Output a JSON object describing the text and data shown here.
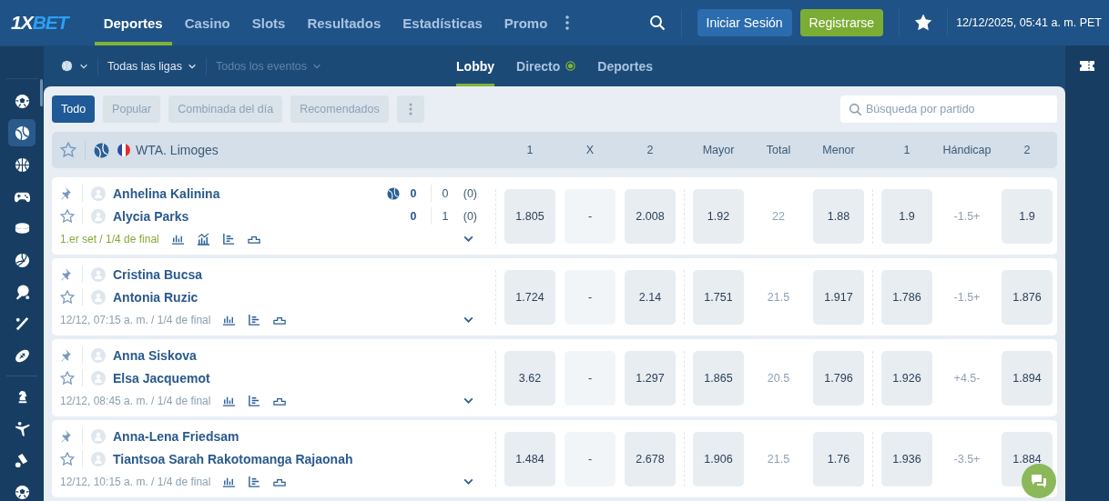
{
  "header": {
    "logo": [
      "1X",
      "BET"
    ],
    "nav": [
      {
        "label": "Deportes",
        "selected": true
      },
      {
        "label": "Casino",
        "selected": false
      },
      {
        "label": "Slots",
        "selected": false
      },
      {
        "label": "Resultados",
        "selected": false
      },
      {
        "label": "Estadísticas",
        "selected": false
      },
      {
        "label": "Promo",
        "selected": false
      }
    ],
    "login": "Iniciar Sesión",
    "register": "Registrarse",
    "datetime": "12/12/2025, 05:41 a. m. PET"
  },
  "sidebar": {
    "items": [
      {
        "kind": "soccer",
        "selected": false
      },
      {
        "kind": "tennis",
        "selected": true
      },
      {
        "kind": "basketball",
        "selected": false
      },
      {
        "kind": "gamepad",
        "selected": false
      },
      {
        "kind": "puck",
        "selected": false
      },
      {
        "kind": "volleyball",
        "selected": false
      },
      {
        "kind": "pingpong",
        "selected": false
      },
      {
        "kind": "cricket",
        "selected": false
      },
      {
        "kind": "rugby",
        "selected": false
      },
      {
        "kind": "chess",
        "selected": false
      },
      {
        "kind": "kick",
        "selected": false
      },
      {
        "kind": "shuttlecock",
        "selected": false
      },
      {
        "kind": "soccer",
        "selected": false
      }
    ]
  },
  "subbar": {
    "leagues": {
      "label": "Todas las ligas",
      "disabled": false
    },
    "events": {
      "label": "Todos los eventos",
      "disabled": true
    },
    "tabs": [
      {
        "label": "Lobby",
        "selected": true,
        "live": false
      },
      {
        "label": "Directo",
        "selected": false,
        "live": true
      },
      {
        "label": "Deportes",
        "selected": false,
        "live": false
      }
    ]
  },
  "filters": {
    "chips": [
      {
        "label": "Todo",
        "selected": true
      },
      {
        "label": "Popular",
        "selected": false
      },
      {
        "label": "Combinada del día",
        "selected": false
      },
      {
        "label": "Recomendados",
        "selected": false
      }
    ],
    "search": {
      "placeholder": "Búsqueda por partido"
    }
  },
  "league": {
    "name": "WTA. Limoges",
    "columns": [
      "1",
      "X",
      "2",
      "Mayor",
      "Total",
      "Menor",
      "1",
      "Hándicap",
      "2"
    ]
  },
  "matches": [
    {
      "teams": [
        {
          "name": "Anhelina Kalinina",
          "serving": true,
          "score": [
            "0",
            "0",
            "(0)"
          ]
        },
        {
          "name": "Alycia Parks",
          "serving": false,
          "score": [
            "0",
            "1",
            "(0)"
          ]
        }
      ],
      "info": "1.er set / 1/4 de final",
      "live": true,
      "stats": [
        {
          "kind": "bars"
        },
        {
          "kind": "trend"
        },
        {
          "kind": "list"
        },
        {
          "kind": "podium"
        }
      ],
      "odds": [
        {
          "kind": "odd",
          "value": "1.805"
        },
        {
          "kind": "off",
          "value": "-"
        },
        {
          "kind": "odd",
          "value": "2.008"
        },
        {
          "kind": "odd",
          "value": "1.92"
        },
        {
          "kind": "param",
          "value": "22"
        },
        {
          "kind": "odd",
          "value": "1.88"
        },
        {
          "kind": "odd",
          "value": "1.9"
        },
        {
          "kind": "param",
          "value": "-1.5+"
        },
        {
          "kind": "odd",
          "value": "1.9"
        }
      ]
    },
    {
      "teams": [
        {
          "name": "Cristina Bucsa"
        },
        {
          "name": "Antonia Ruzic"
        }
      ],
      "info": "12/12, 07:15 a. m. / 1/4 de final",
      "live": false,
      "stats": [
        {
          "kind": "bars"
        },
        {
          "kind": "list"
        },
        {
          "kind": "podium"
        }
      ],
      "odds": [
        {
          "kind": "odd",
          "value": "1.724"
        },
        {
          "kind": "off",
          "value": "-"
        },
        {
          "kind": "odd",
          "value": "2.14"
        },
        {
          "kind": "odd",
          "value": "1.751"
        },
        {
          "kind": "param",
          "value": "21.5"
        },
        {
          "kind": "odd",
          "value": "1.917"
        },
        {
          "kind": "odd",
          "value": "1.786"
        },
        {
          "kind": "param",
          "value": "-1.5+"
        },
        {
          "kind": "odd",
          "value": "1.876"
        }
      ]
    },
    {
      "teams": [
        {
          "name": "Anna Siskova"
        },
        {
          "name": "Elsa Jacquemot"
        }
      ],
      "info": "12/12, 08:45 a. m. / 1/4 de final",
      "live": false,
      "stats": [
        {
          "kind": "bars"
        },
        {
          "kind": "list"
        },
        {
          "kind": "podium"
        }
      ],
      "odds": [
        {
          "kind": "odd",
          "value": "3.62"
        },
        {
          "kind": "off",
          "value": "-"
        },
        {
          "kind": "odd",
          "value": "1.297"
        },
        {
          "kind": "odd",
          "value": "1.865"
        },
        {
          "kind": "param",
          "value": "20.5"
        },
        {
          "kind": "odd",
          "value": "1.796"
        },
        {
          "kind": "odd",
          "value": "1.926"
        },
        {
          "kind": "param",
          "value": "+4.5-"
        },
        {
          "kind": "odd",
          "value": "1.894"
        }
      ]
    },
    {
      "teams": [
        {
          "name": "Anna-Lena Friedsam"
        },
        {
          "name": "Tiantsoa Sarah Rakotomanga Rajaonah"
        }
      ],
      "info": "12/12, 10:15 a. m. / 1/4 de final",
      "live": false,
      "stats": [
        {
          "kind": "bars"
        },
        {
          "kind": "list"
        },
        {
          "kind": "podium"
        }
      ],
      "odds": [
        {
          "kind": "odd",
          "value": "1.484"
        },
        {
          "kind": "off",
          "value": "-"
        },
        {
          "kind": "odd",
          "value": "2.678"
        },
        {
          "kind": "odd",
          "value": "1.906"
        },
        {
          "kind": "param",
          "value": "21.5"
        },
        {
          "kind": "odd",
          "value": "1.76"
        },
        {
          "kind": "odd",
          "value": "1.936"
        },
        {
          "kind": "param",
          "value": "-3.5+"
        },
        {
          "kind": "odd",
          "value": "1.884"
        }
      ]
    }
  ]
}
